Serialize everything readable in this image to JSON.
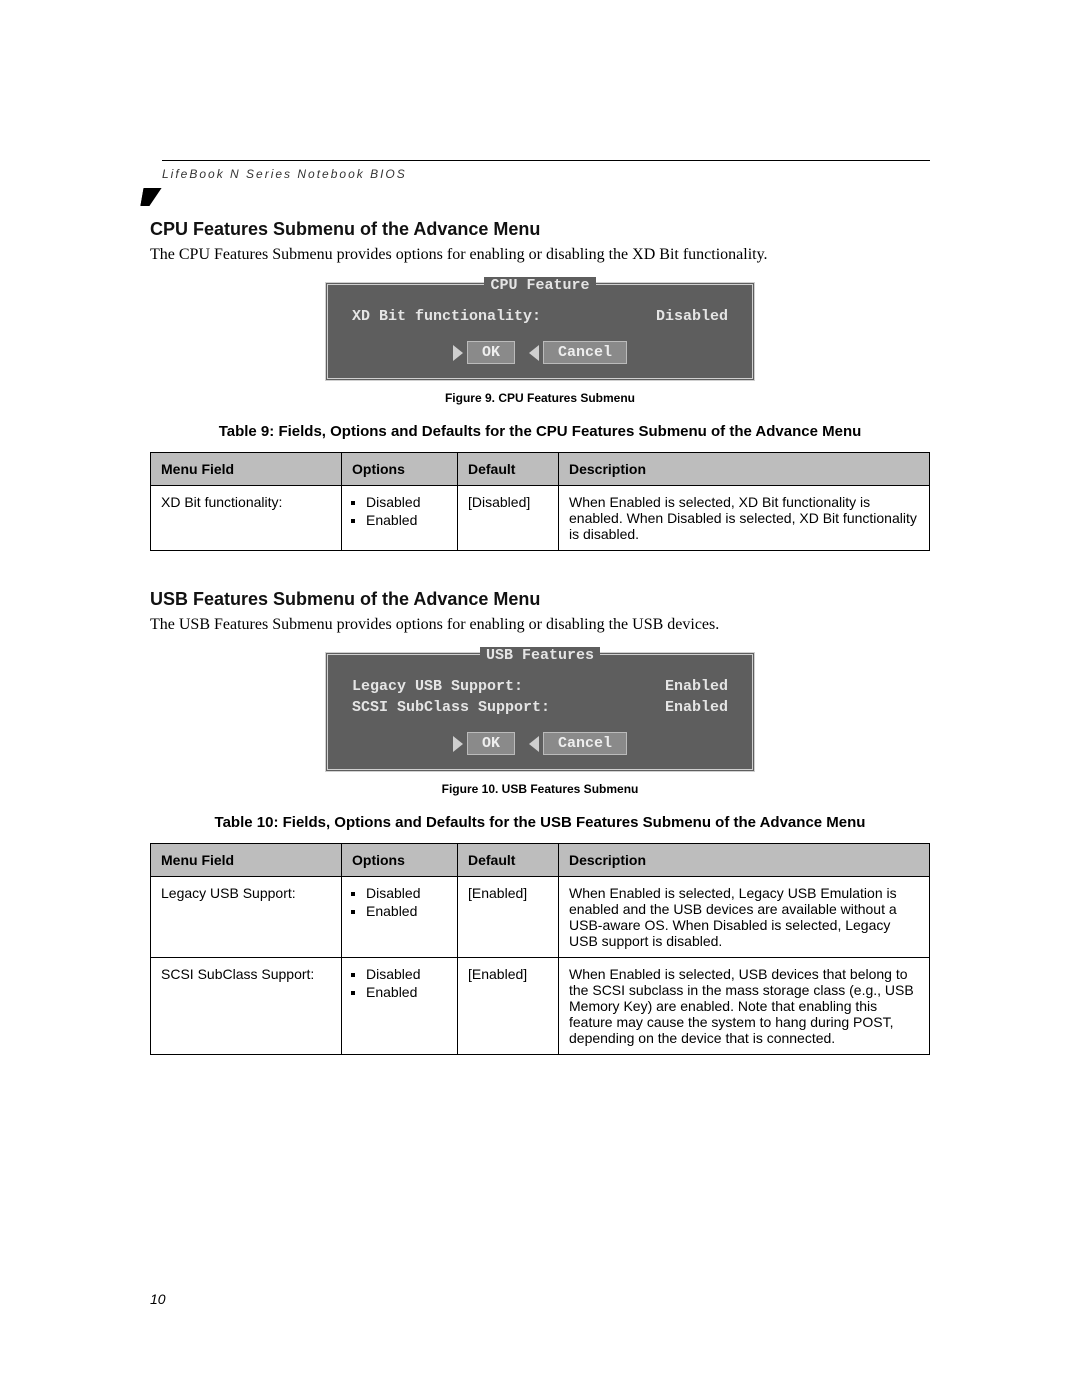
{
  "header": "LifeBook N Series Notebook BIOS",
  "pageNumber": "10",
  "section1": {
    "heading": "CPU Features Submenu of the Advance Menu",
    "intro": "The CPU Features Submenu provides options for enabling or disabling the XD Bit functionality.",
    "biosTitle": "CPU Feature",
    "biosLines": [
      {
        "label": "XD Bit functionality:",
        "value": "Disabled"
      }
    ],
    "ok": "OK",
    "cancel": "Cancel",
    "figCaption": "Figure 9.  CPU Features Submenu",
    "tableTitle": "Table 9: Fields, Options and Defaults for the CPU Features Submenu of the Advance Menu",
    "tableHeaders": [
      "Menu Field",
      "Options",
      "Default",
      "Description"
    ],
    "rows": [
      {
        "field": "XD Bit functionality:",
        "options": [
          "Disabled",
          "Enabled"
        ],
        "def": "[Disabled]",
        "desc": "When Enabled is selected, XD Bit functionality is enabled. When Disabled is selected, XD Bit functionality is disabled."
      }
    ]
  },
  "section2": {
    "heading": "USB Features Submenu of the Advance Menu",
    "intro": "The USB Features Submenu provides options for enabling or disabling the USB devices.",
    "biosTitle": "USB Features",
    "biosLines": [
      {
        "label": "Legacy USB Support:",
        "value": "Enabled"
      },
      {
        "label": "SCSI SubClass Support:",
        "value": "Enabled"
      }
    ],
    "ok": "OK",
    "cancel": "Cancel",
    "figCaption": "Figure 10.  USB Features Submenu",
    "tableTitle": "Table 10: Fields, Options and Defaults for the USB Features Submenu of the Advance Menu",
    "tableHeaders": [
      "Menu Field",
      "Options",
      "Default",
      "Description"
    ],
    "rows": [
      {
        "field": "Legacy USB Support:",
        "options": [
          "Disabled",
          "Enabled"
        ],
        "def": "[Enabled]",
        "desc": "When Enabled is selected, Legacy USB Emulation is enabled and the USB devices are available without a USB-aware OS. When Disabled is selected, Legacy USB support is disabled."
      },
      {
        "field": "SCSI SubClass Support:",
        "options": [
          "Disabled",
          "Enabled"
        ],
        "def": "[Enabled]",
        "desc": "When Enabled is selected, USB devices that belong to the SCSI subclass in the mass storage class (e.g., USB Memory Key) are enabled. Note that enabling this feature may cause the system to hang during POST, depending on the device that is connected."
      }
    ]
  }
}
